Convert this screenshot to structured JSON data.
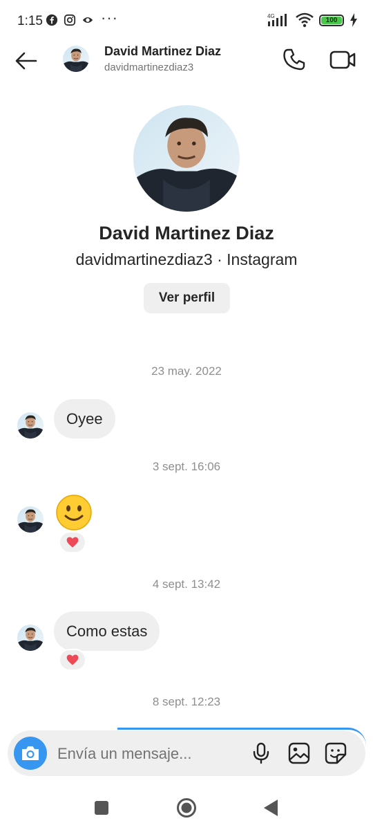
{
  "status_bar": {
    "time": "1:15",
    "network": "4G",
    "battery": "100",
    "more": "···",
    "icons": [
      "facebook-icon",
      "instagram-icon",
      "app-icon",
      "signal-icon",
      "wifi-icon",
      "battery-icon",
      "charging-icon"
    ]
  },
  "header": {
    "name": "David Martinez Diaz",
    "username": "davidmartinezdiaz3",
    "icons": [
      "back-arrow-icon",
      "phone-icon",
      "video-camera-icon"
    ]
  },
  "profile": {
    "name": "David Martinez Diaz",
    "subtitle": "davidmartinezdiaz3 · Instagram",
    "view_profile_label": "Ver perfil"
  },
  "messages": [
    {
      "timestamp": "23 may. 2022",
      "text": "Oyee",
      "reaction": ""
    },
    {
      "timestamp": "3 sept. 16:06",
      "text": "",
      "emoji": "slightly-smiling-face",
      "reaction": "heart"
    },
    {
      "timestamp": "4 sept. 13:42",
      "text": "Como estas",
      "reaction": "heart"
    },
    {
      "timestamp": "8 sept. 12:23"
    }
  ],
  "composer": {
    "placeholder": "Envía un mensaje...",
    "icons": [
      "camera-icon",
      "microphone-icon",
      "gallery-icon",
      "sticker-icon"
    ]
  },
  "nav_bar": {
    "icons": [
      "recents-icon",
      "home-icon",
      "back-icon"
    ]
  },
  "colors": {
    "accent": "#3797f0",
    "bubble": "#efefef",
    "timestamp": "#8e8e8e",
    "heart": "#ed4956",
    "battery": "#49c74a"
  }
}
